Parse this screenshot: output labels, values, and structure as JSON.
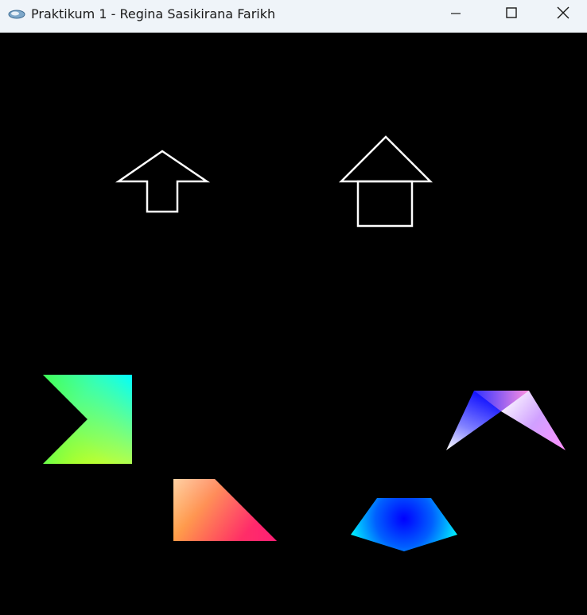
{
  "window": {
    "title": "Praktikum 1 - Regina Sasikirana Farikh",
    "app_icon": "opengl-app-icon",
    "controls": {
      "minimize_icon": "minimize-icon",
      "maximize_icon": "maximize-icon",
      "close_icon": "close-icon"
    }
  },
  "canvas": {
    "background": "#000000",
    "outline_color": "#ffffff",
    "shapes": [
      {
        "name": "arrow-up-outline-shape",
        "style": "outline"
      },
      {
        "name": "house-outline-shape",
        "style": "outline"
      },
      {
        "name": "gradient-arrow-quad-shape",
        "style": "gradient",
        "colors": [
          "#00ff00",
          "#00ffff",
          "#ffff00"
        ]
      },
      {
        "name": "gradient-trapezoid-shape",
        "style": "gradient",
        "colors": [
          "#ffffff",
          "#ff8000",
          "#ff0080"
        ]
      },
      {
        "name": "gradient-pentagon-shape",
        "style": "gradient",
        "colors": [
          "#0000ff",
          "#00ffff"
        ]
      },
      {
        "name": "gradient-chevron-shape",
        "style": "gradient",
        "colors": [
          "#0000ff",
          "#ffffff",
          "#ff80ff"
        ]
      }
    ]
  }
}
